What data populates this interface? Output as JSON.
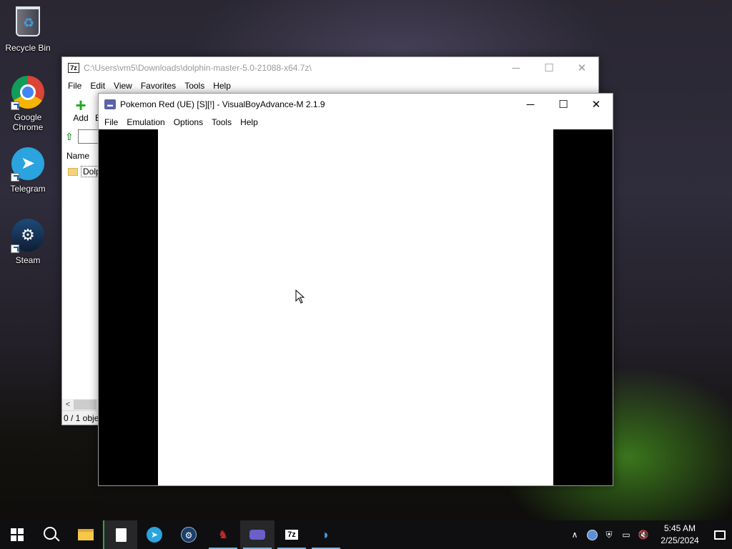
{
  "desktop": {
    "icons": [
      {
        "label": "Recycle Bin",
        "icon": "recycle-bin-icon"
      },
      {
        "label": "Google Chrome",
        "icon": "chrome-icon"
      },
      {
        "label": "Telegram",
        "icon": "telegram-icon"
      },
      {
        "label": "Steam",
        "icon": "steam-icon"
      }
    ]
  },
  "sevenzip": {
    "title": "C:\\Users\\vm5\\Downloads\\dolphin-master-5.0-21088-x64.7z\\",
    "icon_text": "7z",
    "menu": [
      "File",
      "Edit",
      "View",
      "Favorites",
      "Tools",
      "Help"
    ],
    "toolbar": {
      "add_label": "Add",
      "extract_label_partial": "E"
    },
    "column_name": "Name",
    "row_name_partial": "Dolpl",
    "status_partial": "0 / 1 obje"
  },
  "vba": {
    "title": "Pokemon Red (UE) [S][!] - VisualBoyAdvance-M 2.1.9",
    "menu": [
      "File",
      "Emulation",
      "Options",
      "Tools",
      "Help"
    ]
  },
  "taskbar": {
    "time": "5:45 AM",
    "date": "2/25/2024",
    "accent_color": "#7fb4e6"
  }
}
